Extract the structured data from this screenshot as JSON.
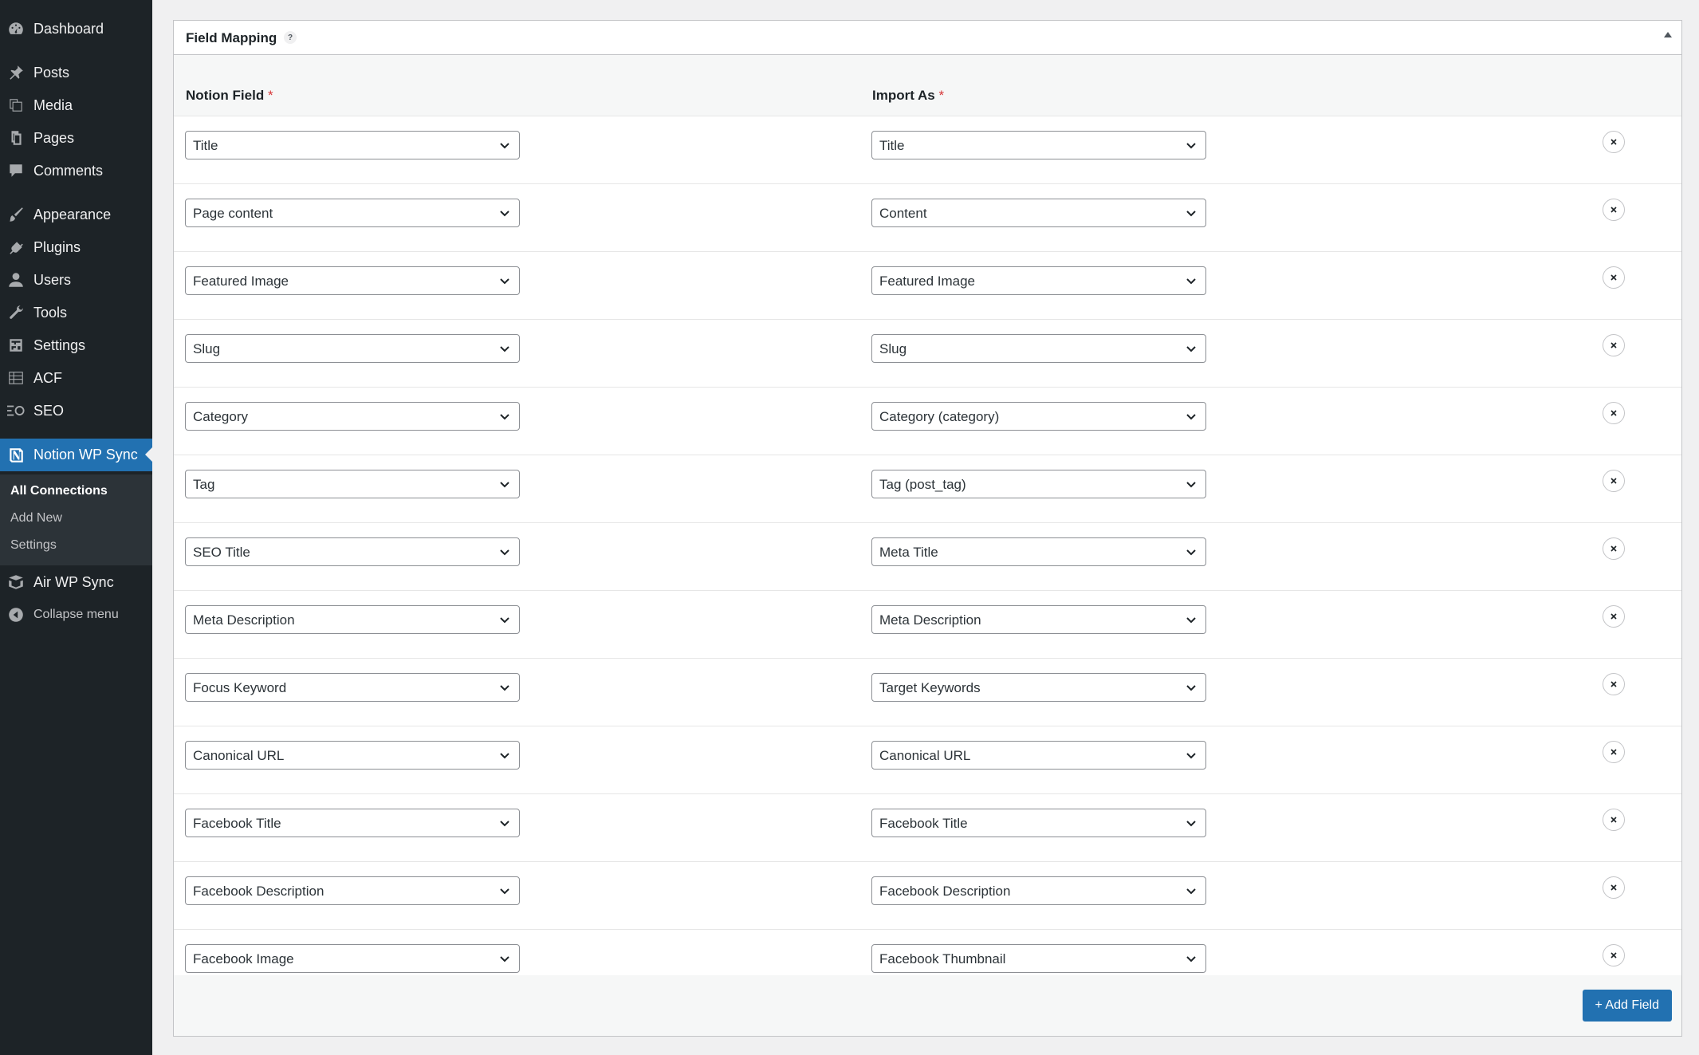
{
  "sidebar": {
    "items": [
      {
        "label": "Dashboard",
        "icon": "dashboard-icon"
      },
      {
        "label": "Posts",
        "icon": "pin-icon"
      },
      {
        "label": "Media",
        "icon": "media-icon"
      },
      {
        "label": "Pages",
        "icon": "pages-icon"
      },
      {
        "label": "Comments",
        "icon": "comment-icon"
      },
      {
        "label": "Appearance",
        "icon": "brush-icon"
      },
      {
        "label": "Plugins",
        "icon": "plug-icon"
      },
      {
        "label": "Users",
        "icon": "user-icon"
      },
      {
        "label": "Tools",
        "icon": "wrench-icon"
      },
      {
        "label": "Settings",
        "icon": "settings-icon"
      },
      {
        "label": "ACF",
        "icon": "grid-icon"
      },
      {
        "label": "SEO",
        "icon": "seo-icon"
      },
      {
        "label": "Notion WP Sync",
        "icon": "notion-icon"
      },
      {
        "label": "Air WP Sync",
        "icon": "layers-icon"
      }
    ],
    "submenu": [
      {
        "label": "All Connections"
      },
      {
        "label": "Add New"
      },
      {
        "label": "Settings"
      }
    ],
    "collapse_label": "Collapse menu"
  },
  "panel": {
    "title": "Field Mapping",
    "help": "?",
    "col_notion": "Notion Field",
    "col_import": "Import As",
    "required_mark": "*",
    "rows": [
      {
        "notion": "Title",
        "import": "Title"
      },
      {
        "notion": "Page content",
        "import": "Content"
      },
      {
        "notion": "Featured Image",
        "import": "Featured Image"
      },
      {
        "notion": "Slug",
        "import": "Slug"
      },
      {
        "notion": "Category",
        "import": "Category (category)"
      },
      {
        "notion": "Tag",
        "import": "Tag (post_tag)"
      },
      {
        "notion": "SEO Title",
        "import": "Meta Title"
      },
      {
        "notion": "Meta Description",
        "import": "Meta Description"
      },
      {
        "notion": "Focus Keyword",
        "import": "Target Keywords"
      },
      {
        "notion": "Canonical URL",
        "import": "Canonical URL"
      },
      {
        "notion": "Facebook Title",
        "import": "Facebook Title"
      },
      {
        "notion": "Facebook Description",
        "import": "Facebook Description"
      },
      {
        "notion": "Facebook Image",
        "import": "Facebook Thumbnail"
      }
    ],
    "add_field_label": "+ Add Field"
  },
  "colors": {
    "sidebar_bg": "#1d2327",
    "accent": "#2271b1",
    "required": "#d63638"
  }
}
